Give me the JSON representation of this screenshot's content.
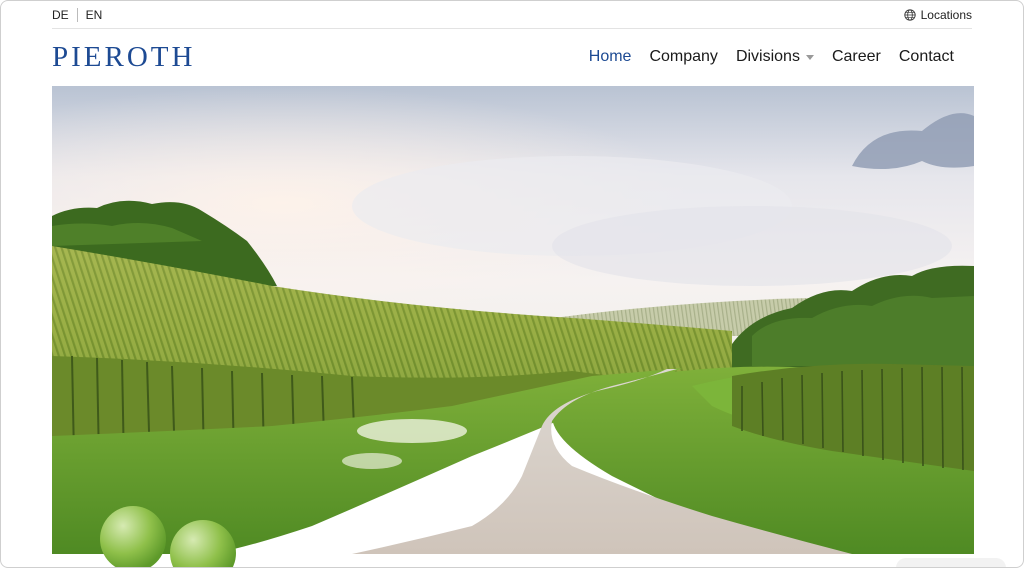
{
  "utility": {
    "languages": [
      "DE",
      "EN"
    ],
    "locations_label": "Locations",
    "locations_icon": "globe-icon"
  },
  "header": {
    "logo_text": "PIEROTH",
    "nav": [
      {
        "label": "Home",
        "active": true
      },
      {
        "label": "Company",
        "active": false
      },
      {
        "label": "Divisions",
        "active": false,
        "has_dropdown": true
      },
      {
        "label": "Career",
        "active": false
      },
      {
        "label": "Contact",
        "active": false
      }
    ]
  },
  "colors": {
    "brand_blue": "#1d4a93",
    "text": "#1a1a1a",
    "divider": "#e3e3e3"
  },
  "hero": {
    "image": "vineyard-landscape-with-path"
  }
}
